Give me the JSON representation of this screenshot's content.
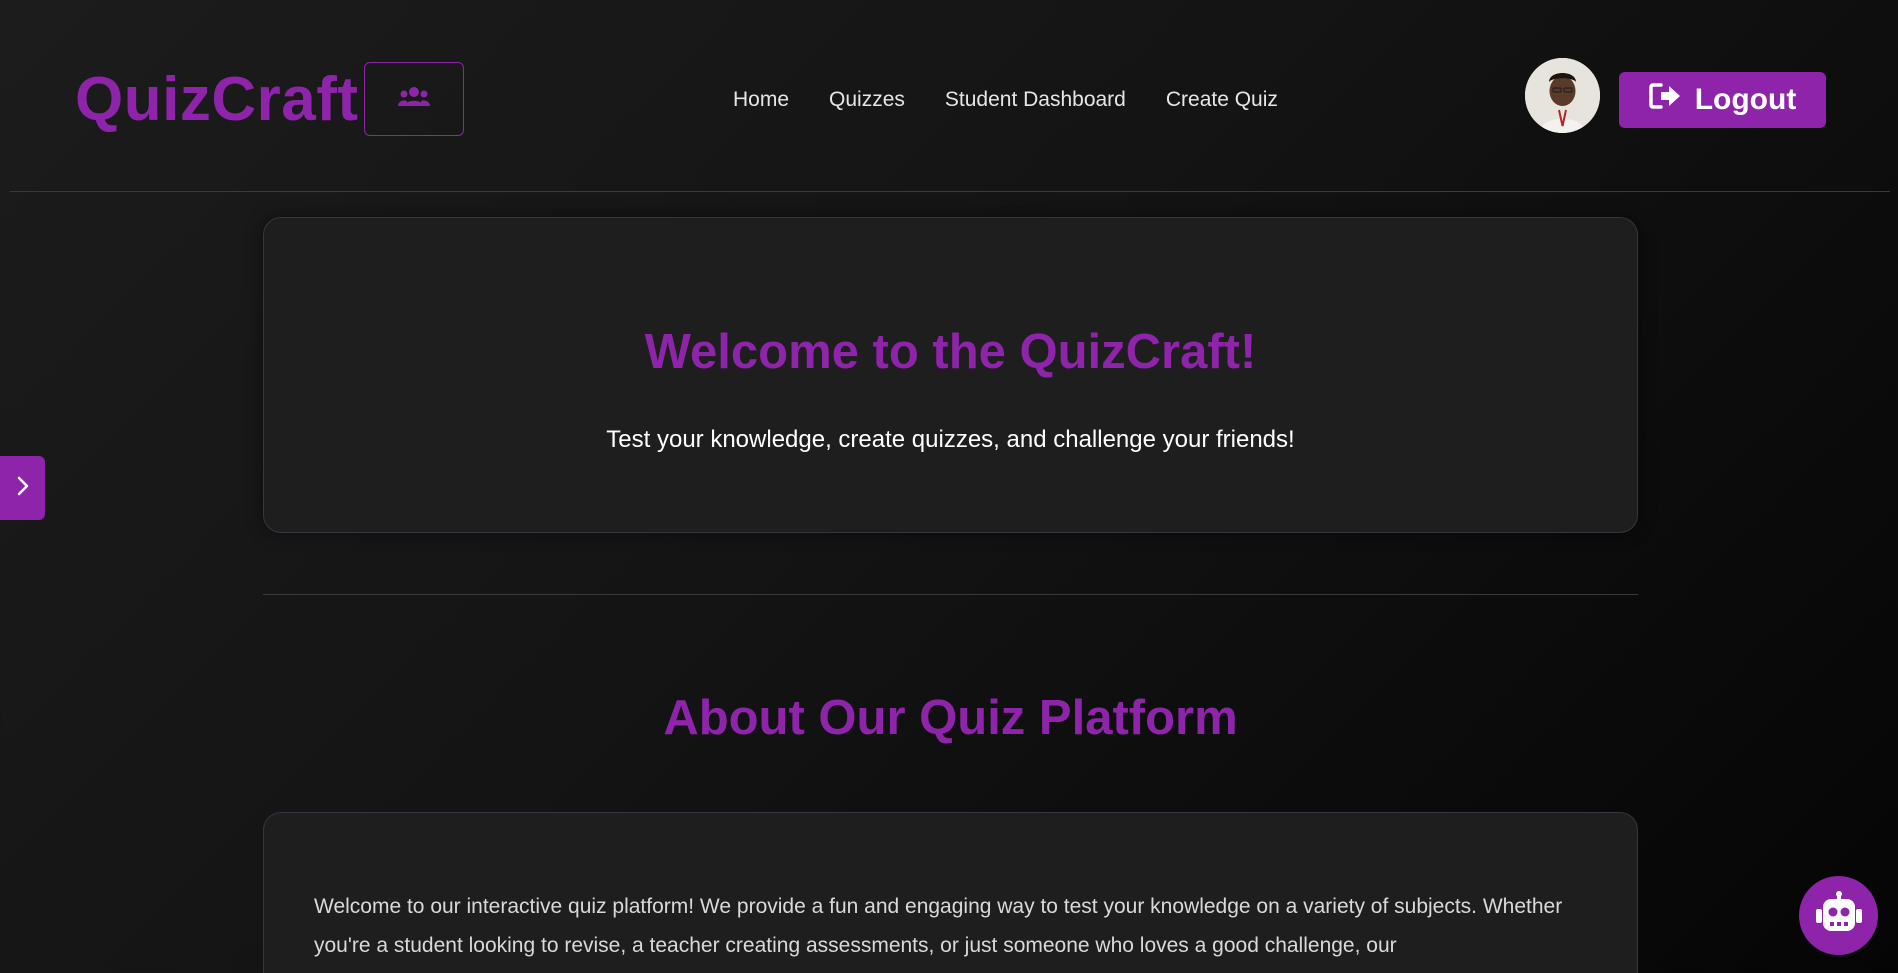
{
  "header": {
    "brand": "QuizCraft",
    "group_icon": "users-icon",
    "nav": [
      {
        "label": "Home"
      },
      {
        "label": "Quizzes"
      },
      {
        "label": "Student Dashboard"
      },
      {
        "label": "Create Quiz"
      }
    ],
    "logout_label": "Logout",
    "logout_icon": "sign-out-icon"
  },
  "hero": {
    "title": "Welcome to the QuizCraft!",
    "subtitle": "Test your knowledge, create quizzes, and challenge your friends!"
  },
  "about": {
    "title": "About Our Quiz Platform",
    "text": "Welcome to our interactive quiz platform! We provide a fun and engaging way to test your knowledge on a variety of subjects. Whether you're a student looking to revise, a teacher creating assessments, or just someone who loves a good challenge, our"
  },
  "widgets": {
    "sidebar_toggle_icon": "chevron-right-icon",
    "chatbot_icon": "robot-icon"
  },
  "colors": {
    "accent": "#8e24aa",
    "background": "#141414",
    "card": "#1e1e1e"
  }
}
